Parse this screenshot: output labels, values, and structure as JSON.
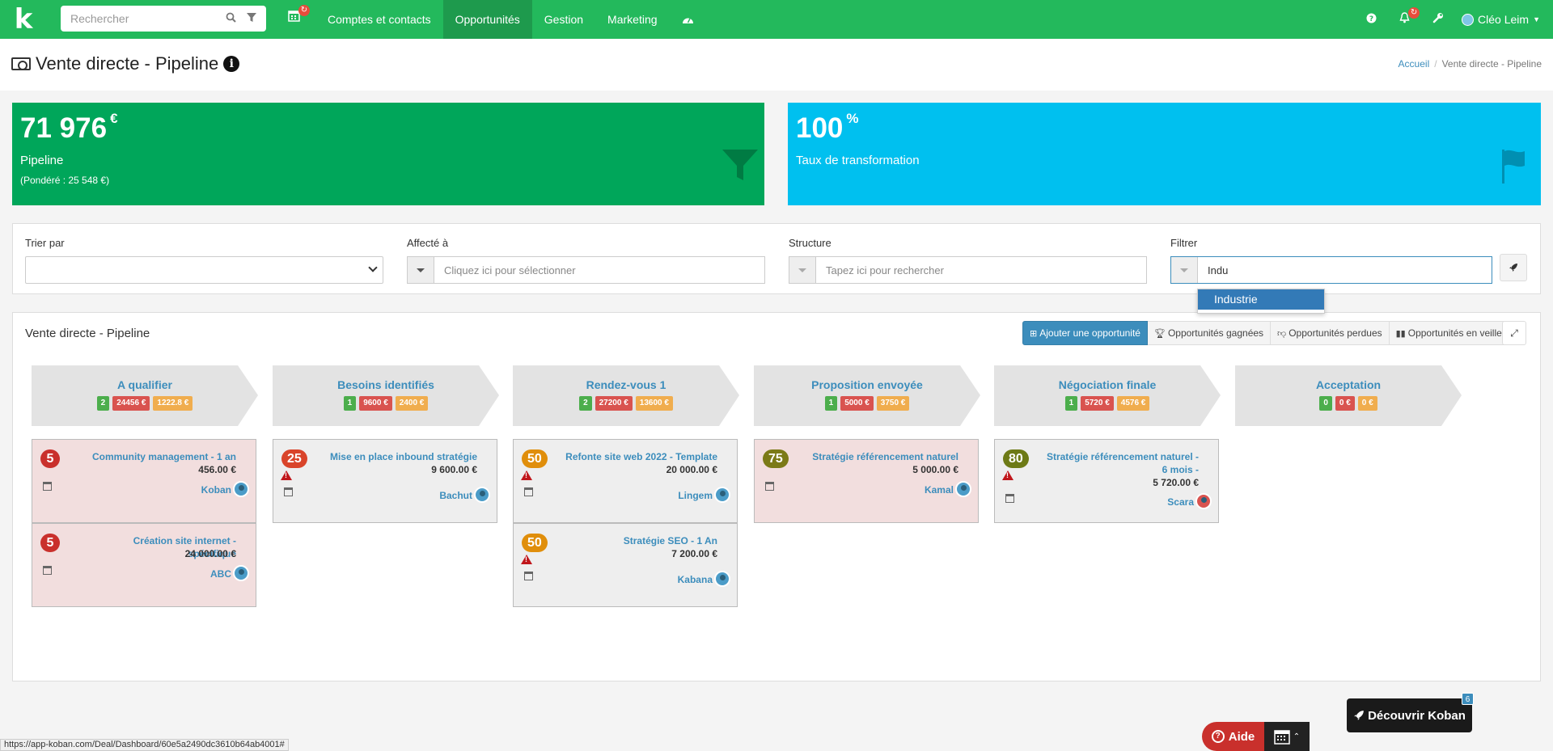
{
  "nav": {
    "search_placeholder": "Rechercher",
    "calendar_badge": "↻",
    "items": [
      "Comptes et contacts",
      "Opportunités",
      "Gestion",
      "Marketing"
    ],
    "notification_badge": "↻",
    "user_name": "Cléo Leim"
  },
  "header": {
    "title": "Vente directe - Pipeline",
    "breadcrumb_home": "Accueil",
    "breadcrumb_current": "Vente directe - Pipeline"
  },
  "kpis": {
    "pipeline_value": "71 976",
    "pipeline_unit": "€",
    "pipeline_label": "Pipeline",
    "pipeline_weighted": "(Pondéré : 25 548 €)",
    "rate_value": "100",
    "rate_unit": "%",
    "rate_label": "Taux de transformation"
  },
  "filters": {
    "sort_label": "Trier par",
    "assigned_label": "Affecté à",
    "assigned_placeholder": "Cliquez ici pour sélectionner",
    "structure_label": "Structure",
    "structure_placeholder": "Tapez ici pour rechercher",
    "filter_label": "Filtrer",
    "filter_value": "Indu",
    "suggestion": "Industrie"
  },
  "pipeline": {
    "title": "Vente directe - Pipeline",
    "add_button": "Ajouter une opportunité",
    "won_button": "Opportunités gagnées",
    "lost_button": "Opportunités perdues",
    "standby_button": "Opportunités en veille",
    "stages": [
      {
        "name": "A qualifier",
        "count": "2",
        "amount": "24456 €",
        "weighted": "1222.8 €"
      },
      {
        "name": "Besoins identifiés",
        "count": "1",
        "amount": "9600 €",
        "weighted": "2400 €"
      },
      {
        "name": "Rendez-vous 1",
        "count": "2",
        "amount": "27200 €",
        "weighted": "13600 €"
      },
      {
        "name": "Proposition envoyée",
        "count": "1",
        "amount": "5000 €",
        "weighted": "3750 €"
      },
      {
        "name": "Négociation finale",
        "count": "1",
        "amount": "5720 €",
        "weighted": "4576 €"
      },
      {
        "name": "Acceptation",
        "count": "0",
        "amount": "0 €",
        "weighted": "0 €"
      }
    ],
    "cards": [
      {
        "score": "5",
        "title": "Community management - 1 an",
        "amount": "456.00 €",
        "company": "Koban"
      },
      {
        "score": "5",
        "title": "Création site internet - spécifique",
        "amount": "24 000.00 €",
        "company": "ABC"
      },
      {
        "score": "25",
        "title": "Mise en place inbound stratégie",
        "amount": "9 600.00 €",
        "company": "Bachut"
      },
      {
        "score": "50",
        "title": "Refonte site web 2022 - Template",
        "amount": "20 000.00 €",
        "company": "Lingem"
      },
      {
        "score": "50",
        "title": "Stratégie SEO - 1 An",
        "amount": "7 200.00 €",
        "company": "Kabana"
      },
      {
        "score": "75",
        "title": "Stratégie référencement naturel",
        "amount": "5 000.00 €",
        "company": "Kamal"
      },
      {
        "score": "80",
        "title": "Stratégie référencement naturel - 6 mois -",
        "amount": "5 720.00 €",
        "company": "Scara"
      }
    ]
  },
  "footer": {
    "status_url": "https://app-koban.com/Deal/Dashboard/60e5a2490dc3610b64ab4001#",
    "help_label": "Aide",
    "discover_label": "Découvrir Koban",
    "discover_badge": "6"
  },
  "colors": {
    "brand_green": "#23b95c",
    "kpi_green": "#00a65a",
    "kpi_blue": "#00c0ef",
    "link_blue": "#3c8dbc"
  },
  "icons": [
    "search-icon",
    "filter-icon",
    "calendar-icon",
    "dashboard-icon",
    "help-icon",
    "bell-icon",
    "wrench-icon",
    "funnel-icon",
    "flag-icon",
    "rocket-icon",
    "trophy-icon",
    "thumbs-down-icon",
    "pause-icon",
    "expand-icon",
    "warning-icon"
  ]
}
